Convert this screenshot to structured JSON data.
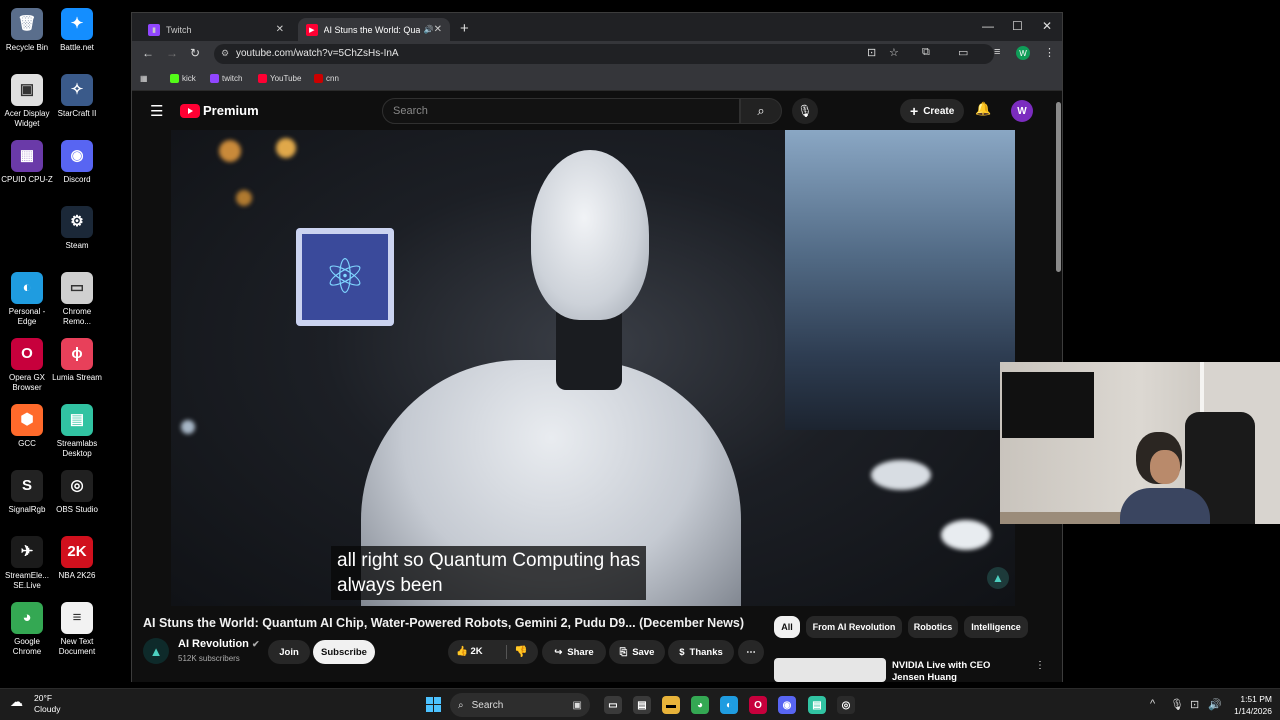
{
  "desktop": {
    "icons": [
      {
        "label": "Recycle Bin",
        "glyph": "🗑",
        "color": "#5a6e8c"
      },
      {
        "label": "Battle.net",
        "glyph": "✦",
        "color": "#148eff"
      },
      {
        "label": "Acer Display Widget",
        "glyph": "▣",
        "color": "#e0e0e0"
      },
      {
        "label": "StarCraft II",
        "glyph": "✧",
        "color": "#3a5a8a"
      },
      {
        "label": "CPUID CPU-Z",
        "glyph": "▦",
        "color": "#6a3aa8"
      },
      {
        "label": "Discord",
        "glyph": "◉",
        "color": "#5865f2"
      },
      {
        "label": "Steam",
        "glyph": "⚙",
        "color": "#1b2838"
      },
      {
        "label": "Personal - Edge",
        "glyph": "◐",
        "color": "#1f9ce0"
      },
      {
        "label": "Chrome Remo...",
        "glyph": "▭",
        "color": "#d0d0d0"
      },
      {
        "label": "Opera GX Browser",
        "glyph": "O",
        "color": "#c7003c"
      },
      {
        "label": "Lumia Stream",
        "glyph": "ϕ",
        "color": "#e8405a"
      },
      {
        "label": "GCC",
        "glyph": "⬢",
        "color": "#ff6a2b"
      },
      {
        "label": "Streamlabs Desktop",
        "glyph": "▤",
        "color": "#31c3a2"
      },
      {
        "label": "SignalRgb",
        "glyph": "S",
        "color": "#222"
      },
      {
        "label": "OBS Studio",
        "glyph": "◎",
        "color": "#202020"
      },
      {
        "label": "StreamEle... SE.Live",
        "glyph": "✈",
        "color": "#1b1b1b"
      },
      {
        "label": "NBA 2K26",
        "glyph": "2K",
        "color": "#d1101d"
      },
      {
        "label": "Google Chrome",
        "glyph": "◕",
        "color": "#34a853"
      },
      {
        "label": "New Text Document",
        "glyph": "≡",
        "color": "#f2f2f2"
      }
    ]
  },
  "browser": {
    "tabs": [
      {
        "label": "Twitch",
        "icon": "twitch-icon",
        "color": "#9146ff"
      },
      {
        "label": "AI Stuns the World: Quantu",
        "icon": "youtube-icon",
        "color": "#ff0033",
        "audio": "🔊"
      }
    ],
    "url": "youtube.com/watch?v=5ChZsHs-InA",
    "bookmarks": [
      {
        "label": "kick",
        "color": "#53fc18"
      },
      {
        "label": "twitch",
        "color": "#9146ff"
      },
      {
        "label": "YouTube",
        "color": "#ff0033"
      },
      {
        "label": "cnn",
        "color": "#cc0000"
      }
    ],
    "profile_initial": "W"
  },
  "youtube": {
    "logo_text": "Premium",
    "search_placeholder": "Search",
    "create_label": "Create",
    "avatar_initial": "W",
    "caption_line1": "all right so Quantum Computing has",
    "caption_line2": "always been",
    "video_title": "AI Stuns the World: Quantum AI Chip, Water-Powered Robots, Gemini 2, Pudu D9... (December News)",
    "channel_name": "AI Revolution",
    "subscribers": "512K subscribers",
    "join_label": "Join",
    "subscribe_label": "Subscribe",
    "like_count": "2K",
    "share_label": "Share",
    "save_label": "Save",
    "thanks_label": "Thanks",
    "chips": [
      "All",
      "From AI Revolution",
      "Robotics",
      "Intelligence"
    ],
    "rec_title": "NVIDIA Live with CEO Jensen Huang"
  },
  "taskbar": {
    "temp": "20°F",
    "condition": "Cloudy",
    "search_label": "Search",
    "time": "1:51 PM",
    "date": "1/14/2026"
  }
}
